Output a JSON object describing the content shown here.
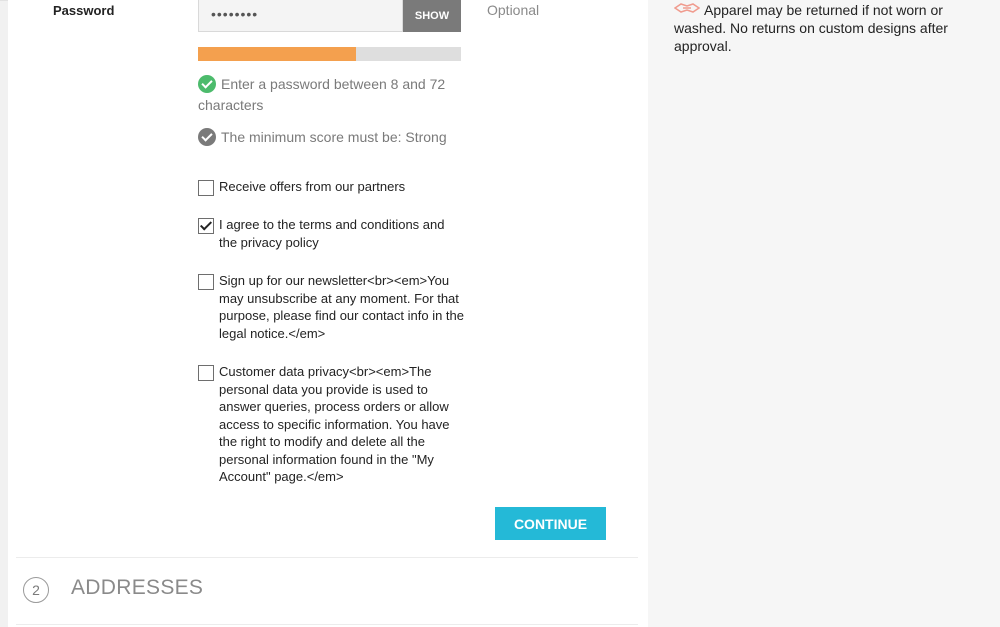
{
  "password": {
    "label": "Password",
    "masked_value": "••••••••",
    "show_button": "SHOW",
    "optional_label": "Optional",
    "strength_fraction": 0.6
  },
  "rules": [
    {
      "text": "Enter a password between 8 and 72 characters",
      "status": "met"
    },
    {
      "text": "The minimum score must be: Strong",
      "status": "unmet"
    }
  ],
  "options": [
    {
      "label": "Receive offers from our partners",
      "checked": false
    },
    {
      "label": "I agree to the terms and conditions and the privacy policy",
      "checked": true
    },
    {
      "label": "Sign up for our newsletter<br><em>You may unsubscribe at any moment. For that purpose, please find our contact info in the legal notice.</em>",
      "checked": false
    },
    {
      "label": "Customer data privacy<br><em>The personal data you provide is used to answer queries, process orders or allow access to specific information. You have the right to modify and delete all the personal information found in the \"My Account\" page.</em>",
      "checked": false
    }
  ],
  "continue_button": "CONTINUE",
  "next_step": {
    "number": "2",
    "title": "ADDRESSES"
  },
  "sidebar": {
    "return_policy": "Apparel may be returned if not worn or washed. No returns on custom designs after approval."
  },
  "colors": {
    "accent": "#24b9d7",
    "strength": "#f4a04e",
    "rule_ok": "#4cbb6c",
    "hand_icon": "#f09b8e"
  },
  "icons": {
    "rule_ok": "check-circle-icon",
    "rule_pending": "check-circle-icon",
    "return": "handshake-icon"
  }
}
